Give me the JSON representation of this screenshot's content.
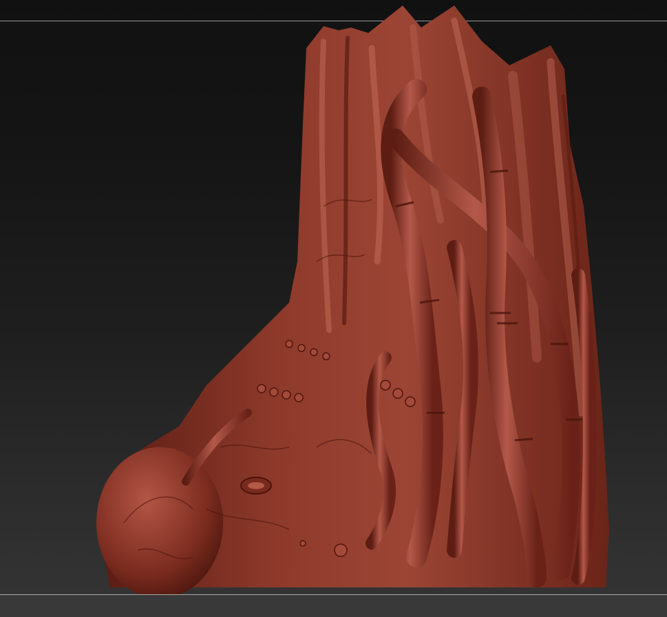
{
  "viewport": {
    "background_top": "#111111",
    "background_bottom": "#333333",
    "frame_line_color": "#9c9c9c"
  },
  "model": {
    "icon": "sculpt-mesh-icon",
    "material_color": "#8a3325",
    "highlight_color": "#c0604c",
    "shadow_color": "#4a150e"
  }
}
